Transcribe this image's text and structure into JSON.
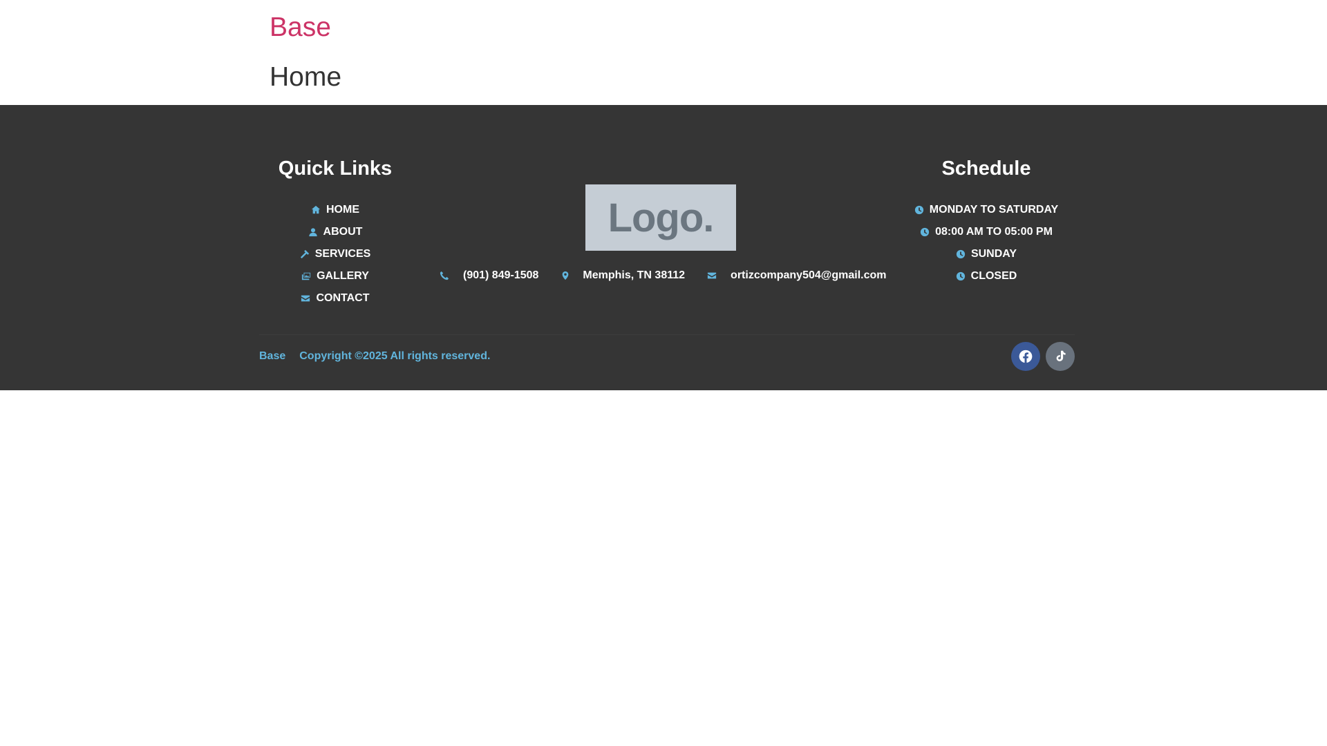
{
  "header": {
    "site_title": "Base",
    "page_title": "Home"
  },
  "quick_links": {
    "title": "Quick Links",
    "items": [
      {
        "label": "HOME",
        "icon": "home-icon"
      },
      {
        "label": "ABOUT",
        "icon": "user-icon"
      },
      {
        "label": "SERVICES",
        "icon": "hammer-icon"
      },
      {
        "label": "GALLERY",
        "icon": "images-icon"
      },
      {
        "label": "CONTACT",
        "icon": "envelope-icon"
      }
    ]
  },
  "logo": {
    "text": "Logo."
  },
  "contact": {
    "phone": "(901) 849-1508",
    "address": "Memphis, TN 38112",
    "email": "ortizcompany504@gmail.com"
  },
  "schedule": {
    "title": "Schedule",
    "items": [
      {
        "label": "MONDAY TO SATURDAY",
        "icon": "clock-icon"
      },
      {
        "label": "08:00 AM TO 05:00 PM",
        "icon": "clock-icon"
      },
      {
        "label": "SUNDAY",
        "icon": "clock-icon"
      },
      {
        "label": "CLOSED",
        "icon": "clock-icon"
      }
    ]
  },
  "bottom_bar": {
    "brand": "Base",
    "copyright": "Copyright ©2025 All rights reserved.",
    "social": [
      {
        "name": "facebook-icon",
        "color": "#3b5998"
      },
      {
        "name": "tiktok-icon",
        "color": "#69727d"
      }
    ]
  },
  "colors": {
    "accent": "#61b5dd",
    "brand_pink": "#cc3366",
    "footer_bg": "#353535"
  }
}
